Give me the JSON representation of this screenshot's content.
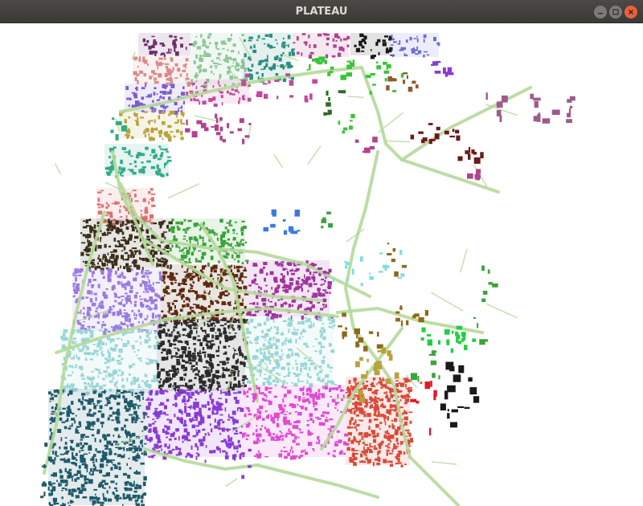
{
  "window": {
    "title": "PLATEAU",
    "controls": {
      "minimize_icon": "minimize-icon",
      "maximize_icon": "maximize-icon",
      "close_icon": "close-icon"
    }
  },
  "scene": {
    "background": "#ffffff",
    "road_color": "#b5d99a",
    "district_colors": [
      "#6b2f6b",
      "#8fc79a",
      "#2a8f7f",
      "#b0448e",
      "#1a1a1a",
      "#6d6dd6",
      "#d98a8a",
      "#7a5cd1",
      "#c24a9c",
      "#8f5a2a",
      "#2f9a6a",
      "#3ac43a",
      "#b8a23a",
      "#33aa88",
      "#e07070",
      "#3a2e1a",
      "#3aa33a",
      "#5c2a10",
      "#a033a0",
      "#9a7ae0",
      "#9ad6d6",
      "#2b2b2b",
      "#8e6a1a",
      "#1f5a6a",
      "#8a3ad6",
      "#e04ad6",
      "#d94a3a",
      "#e01a2a",
      "#3a7ae0",
      "#7ae0e0",
      "#20d040",
      "#6a1a1a",
      "#a05a8a",
      "#2f6a2a"
    ]
  }
}
